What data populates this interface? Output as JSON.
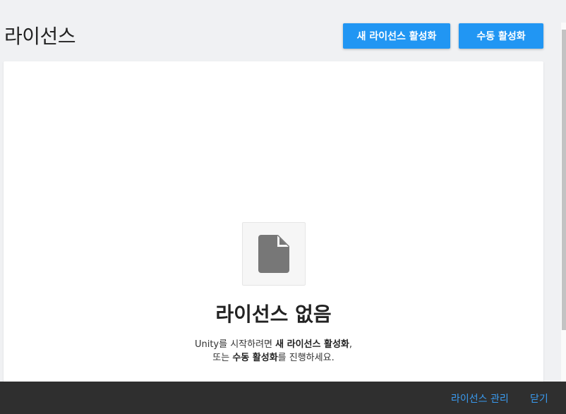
{
  "header": {
    "title": "라이선스",
    "activate_new_label": "새 라이선스 활성화",
    "manual_activate_label": "수동 활성화"
  },
  "empty_state": {
    "icon": "document-icon",
    "title": "라이선스 없음",
    "desc_line1_prefix": "Unity를 시작하려면 ",
    "desc_line1_bold": "새 라이선스 활성화",
    "desc_line1_suffix": ",",
    "desc_line2_prefix": "또는 ",
    "desc_line2_bold": "수동 활성화",
    "desc_line2_suffix": "를 진행하세요."
  },
  "footer": {
    "manage_label": "라이선스 관리",
    "close_label": "닫기"
  },
  "colors": {
    "accent": "#2196f3",
    "link": "#3a9bf0",
    "footer_bg": "#2f2f2f",
    "icon_gray": "#777777"
  }
}
